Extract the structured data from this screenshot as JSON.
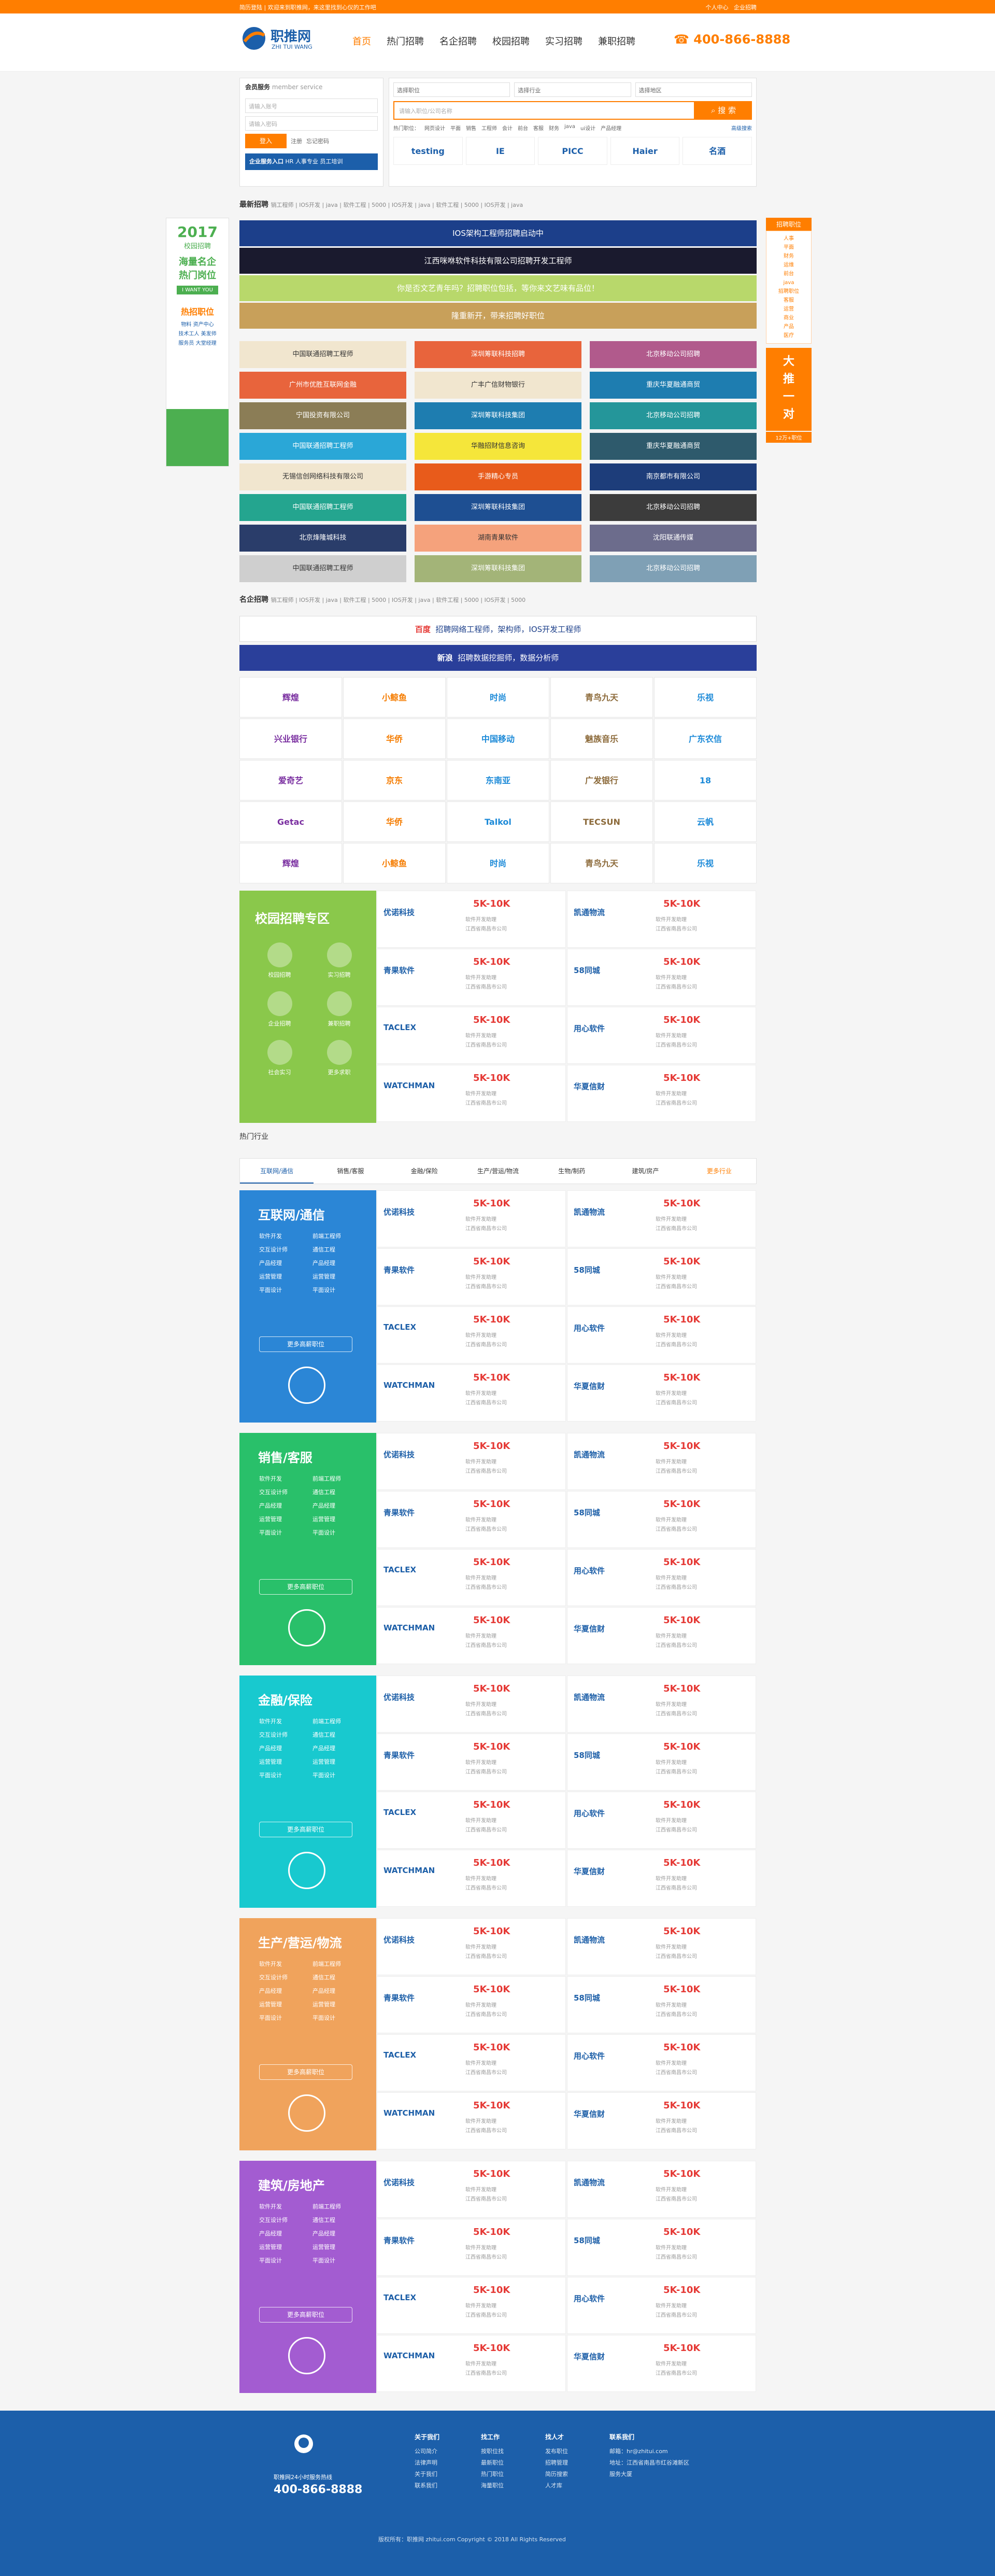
{
  "topbar": {
    "left": [
      "简历登陆",
      "|",
      "欢迎来到职推网，来这里找到心仪的工作吧"
    ],
    "right": [
      "个人中心",
      "企业招聘"
    ]
  },
  "logo": {
    "cn": "职推网",
    "en": "ZHI TUI WANG"
  },
  "nav": [
    "首页",
    "热门招聘",
    "名企招聘",
    "校园招聘",
    "实习招聘",
    "兼职招聘"
  ],
  "hotline": "400-866-8888",
  "login": {
    "title": "会员服务",
    "title_en": "member service",
    "user_ph": "请输入账号",
    "pass_ph": "请输入密码",
    "btn": "登入",
    "register": "注册",
    "forgot": "忘记密码",
    "ent": "企业服务入口",
    "ent2": "HR 人事专业  员工培训"
  },
  "search": {
    "sel1": "选择职位",
    "sel2": "选择行业",
    "sel3": "选择地区",
    "ph": "请输入职位/公司名称",
    "btn": "搜 索",
    "hot": [
      "热门职位：",
      "网页设计",
      "平面",
      "销售",
      "工程师",
      "会计",
      "前台",
      "客服",
      "财务",
      "java",
      "ui设计",
      "产品经理"
    ],
    "more": "高级搜索",
    "logos": [
      "testing",
      "IE",
      "PICC",
      "Haier",
      "名酒"
    ]
  },
  "newest": {
    "title": "最新招聘",
    "tags": "销工程师 | IOS开发 | java | 软件工程 | 5000 | IOS开发 | java | 软件工程 | 5000 | IOS开发 | java"
  },
  "banners": [
    "IOS架构工程师招聘启动中",
    "江西咪咻软件科技有限公司招聘开发工程师",
    "你是否文艺青年吗？招聘职位包括，等你来文艺味有品位！",
    "隆重新开，带来招聘好职位"
  ],
  "grid": [
    [
      "中国联通招聘工程师",
      "深圳筹联科技招聘",
      "北京移动公司招聘"
    ],
    [
      "广州市优胜互联网金融",
      "广丰广信财物银行",
      "重庆华夏融通商贸"
    ],
    [
      "宁国投资有限公司",
      "深圳筹联科技集团",
      "北京移动公司招聘"
    ],
    [
      "中国联通招聘工程师",
      "华融招财信息咨询",
      "重庆华夏融通商贸"
    ],
    [
      "无锡信创网络科技有限公司",
      "手游精心专员",
      "南京都市有限公司"
    ],
    [
      "中国联通招聘工程师",
      "深圳筹联科技集团",
      "北京移动公司招聘"
    ],
    [
      "北京烽隆城科技",
      "湖南青果软件",
      "沈阳联通传媒"
    ],
    [
      "中国联通招聘工程师",
      "深圳筹联科技集团",
      "北京移动公司招聘"
    ]
  ],
  "side_left": {
    "year": "2017",
    "t1": "校园招聘",
    "t2": "海量名企",
    "t3": "热门岗位",
    "btn": "I WANT YOU",
    "hot": "热招职位",
    "list": [
      "物料 资产中心",
      "技术工人 美发师",
      "服务员 大堂经理"
    ]
  },
  "side_right": {
    "title": "招聘职位",
    "list": [
      "人事",
      "平面",
      "财务",
      "运维",
      "前台",
      "java",
      "招聘职位",
      "客服",
      "运营",
      "商业",
      "产品",
      "医疗"
    ],
    "cta1": "大",
    "cta2": "推",
    "cta3": "一",
    "cta4": "对",
    "more": "12万+职位"
  },
  "famous": {
    "title": "名企招聘",
    "tags": "销工程师 | IOS开发 | java | 软件工程 | 5000 | IOS开发 | java | 软件工程 | 5000 | IOS开发 | 5000",
    "ad1": "招聘网络工程师，架构师，IOS开发工程师",
    "ad2": "招聘数据挖掘师，数据分析师",
    "ad1logo": "百度",
    "ad2logo": "新浪"
  },
  "logos": [
    [
      "辉煌",
      "小鲸鱼",
      "时尚",
      "青鸟九天",
      "乐视"
    ],
    [
      "兴业银行",
      "华侨",
      "中国移动",
      "魅族音乐",
      "广东农信"
    ],
    [
      "爱奇艺",
      "京东",
      "东南亚",
      "广发银行",
      "18"
    ],
    [
      "Getac",
      "华侨",
      "Talkol",
      "TECSUN",
      "云帆"
    ],
    [
      "辉煌",
      "小鲸鱼",
      "时尚",
      "青鸟九天",
      "乐视"
    ]
  ],
  "campus": {
    "title": "校园招聘专区",
    "items": [
      "校园招聘",
      "实习招聘",
      "企业招聘",
      "兼职招聘",
      "社会实习",
      "更多求职"
    ]
  },
  "jobs": [
    {
      "logo": "优诺科技",
      "sal": "5K-10K",
      "t": "软件开发助理",
      "c": "江西省南昌市公司"
    },
    {
      "logo": "凯通物流",
      "sal": "5K-10K",
      "t": "软件开发助理",
      "c": "江西省南昌市公司"
    },
    {
      "logo": "青果软件",
      "sal": "5K-10K",
      "t": "软件开发助理",
      "c": "江西省南昌市公司"
    },
    {
      "logo": "58同城",
      "sal": "5K-10K",
      "t": "软件开发助理",
      "c": "江西省南昌市公司"
    },
    {
      "logo": "TACLEX",
      "sal": "5K-10K",
      "t": "软件开发助理",
      "c": "江西省南昌市公司"
    },
    {
      "logo": "用心软件",
      "sal": "5K-10K",
      "t": "软件开发助理",
      "c": "江西省南昌市公司"
    },
    {
      "logo": "WATCHMAN",
      "sal": "5K-10K",
      "t": "软件开发助理",
      "c": "江西省南昌市公司"
    },
    {
      "logo": "华夏信财",
      "sal": "5K-10K",
      "t": "软件开发助理",
      "c": "江西省南昌市公司"
    }
  ],
  "hotind": {
    "title": "热门行业",
    "tabs": [
      "互联网/通信",
      "销售/客服",
      "金融/保险",
      "生产/营运/物流",
      "生物/制药",
      "建筑/房产",
      "更多行业"
    ]
  },
  "cats": [
    {
      "title": "互联网/通信",
      "color": "#2b86d6"
    },
    {
      "title": "销售/客服",
      "color": "#29c06a"
    },
    {
      "title": "金融/保险",
      "color": "#18c9cf"
    },
    {
      "title": "生产/营运/物流",
      "color": "#f0a35c"
    },
    {
      "title": "建筑/房地产",
      "color": "#a35cd1"
    }
  ],
  "catlinks": [
    "软件开发",
    "前端工程师",
    "交互设计师",
    "通信工程",
    "产品经理",
    "产品经理",
    "运营管理",
    "运营管理",
    "平面设计",
    "平面设计"
  ],
  "catmore": "更多高薪职位",
  "footer": {
    "hotline": "400-866-8888",
    "label": "职推网24小时服务热线",
    "cols": [
      {
        "h": "关于我们",
        "l": [
          "公司简介",
          "法律声明",
          "关于我们",
          "联系我们"
        ]
      },
      {
        "h": "找工作",
        "l": [
          "按职位找",
          "最新职位",
          "热门职位",
          "海量职位"
        ]
      },
      {
        "h": "找人才",
        "l": [
          "发布职位",
          "招聘管理",
          "简历搜索",
          "人才库"
        ]
      },
      {
        "h": "联系我们",
        "l": [
          "邮箱：hr@zhitui.com",
          "地址：江西省南昌市红谷滩新区",
          "服务大厦"
        ]
      }
    ],
    "copy": "版权所有：职推网 zhitui.com  Copyright © 2018 All Rights Reserved"
  }
}
